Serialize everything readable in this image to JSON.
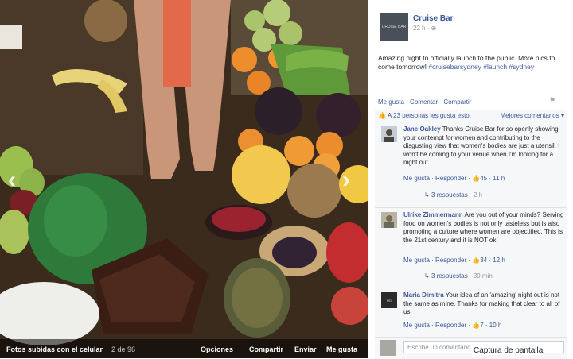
{
  "photo": {
    "album_label": "Fotos subidas con el celular",
    "position": "2 de 96",
    "actions": [
      "Opciones",
      "Compartir",
      "Enviar",
      "Me gusta"
    ]
  },
  "post": {
    "page_name": "Cruise Bar",
    "logo_text": "CRUISE BAR",
    "time": "22 h · ⊕",
    "text": "Amazing night to officially launch to the public. More pics to come tomorrow! ",
    "hashtags": "#cruisebarsydney #launch #sydney",
    "actions": [
      "Me gusta",
      "·",
      "Comentar",
      "·",
      "Compartir"
    ],
    "likes_text": "A 23 personas les gusta esto.",
    "best_comments": "Mejores comentarios ▾"
  },
  "comments": [
    {
      "author": "Jane Oakley",
      "text": " Thanks Cruise Bar for so openly showing your contempt for women and contributing to the disgusting view that women's bodies are just a utensil. I won't be coming to your venue when I'm looking for a night out.",
      "foot": "Me gusta · Responder · 👍45 · 11 h",
      "replies": "3 respuestas",
      "replies_time": " · 2 h"
    },
    {
      "author": "Ulrike Zimmermann",
      "text": " Are you out of your minds? Serving food on women's bodies is not only tasteless but is also promoting a culture where women are objectified. This is the 21st century and it is NOT ok.",
      "foot": "Me gusta · Responder · 👍34 · 12 h",
      "replies": "3 respuestas",
      "replies_time": " · 39 min"
    },
    {
      "author": "Maria Dimitra",
      "text": " Your idea of an 'amazing' night out is not the same as mine. Thanks for making that clear to all of us!",
      "foot": "Me gusta · Responder · 👍7 · 10 h"
    }
  ],
  "composer": {
    "placeholder": "Escribe un comentario..."
  },
  "caption": "Captura de pantalla"
}
